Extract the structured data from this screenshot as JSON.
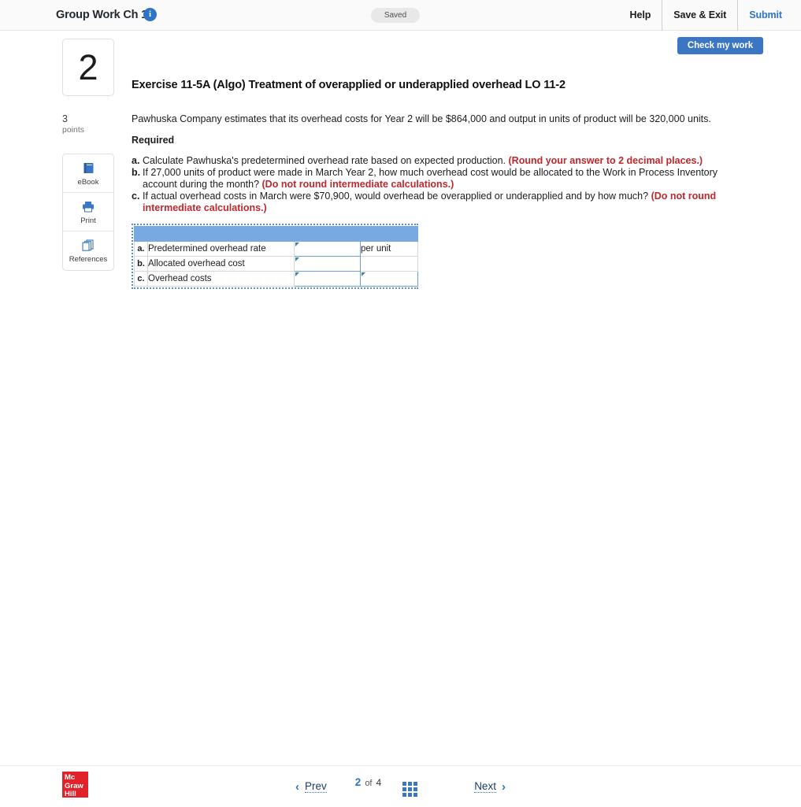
{
  "topbar": {
    "assignment_title": "Group Work Ch 11",
    "info_icon": "info-icon",
    "save_status": "Saved",
    "help_label": "Help",
    "save_exit_label": "Save & Exit",
    "submit_label": "Submit"
  },
  "toolbar": {
    "check_my_work_label": "Check my work"
  },
  "sidebar": {
    "question_number": "2",
    "points_value": "3",
    "points_label": "points",
    "tools": [
      {
        "label": "eBook",
        "icon": "ebook-icon"
      },
      {
        "label": "Print",
        "icon": "print-icon"
      },
      {
        "label": "References",
        "icon": "references-icon"
      }
    ]
  },
  "question": {
    "title": "Exercise 11-5A (Algo) Treatment of overapplied or underapplied overhead LO 11-2",
    "stem": "Pawhuska Company estimates that its overhead costs for Year 2 will be $864,000 and output in units of product will be 320,000 units.",
    "required_label": "Required",
    "requirements": [
      {
        "marker": "a.",
        "text": "Calculate Pawhuska's predetermined overhead rate based on expected production.",
        "highlight": "(Round your answer to 2 decimal places.)"
      },
      {
        "marker": "b.",
        "text": "If 27,000 units of product were made in March Year 2, how much overhead cost would be allocated to the Work in Process Inventory account during the month?",
        "highlight": "(Do not round intermediate calculations.)"
      },
      {
        "marker": "c.",
        "text": "If actual overhead costs in March were $70,900, would overhead be overapplied or underapplied and by how much?",
        "highlight": "(Do not round intermediate calculations.)"
      }
    ]
  },
  "answer_table": {
    "header_cells": [
      "",
      "",
      "",
      ""
    ],
    "rows": [
      {
        "marker": "a.",
        "label": "Predetermined overhead rate",
        "input_value": "",
        "unit_text": "per unit",
        "second_input": false
      },
      {
        "marker": "b.",
        "label": "Allocated overhead cost",
        "input_value": "",
        "unit_text": "",
        "second_input": false
      },
      {
        "marker": "c.",
        "label": "Overhead costs",
        "input_value": "",
        "unit_text": "",
        "second_input": true,
        "second_input_value": ""
      }
    ]
  },
  "footer": {
    "logo_line1": "Mc",
    "logo_line2": "Graw",
    "logo_line3": "Hill",
    "prev_label": "Prev",
    "next_label": "Next",
    "current_page": "2",
    "of_label": "of",
    "total_pages": "4",
    "grid_icon": "grid-view-icon"
  },
  "colors": {
    "accent_blue": "#2e74c8",
    "button_blue": "#3a76c4",
    "table_header_blue": "#78a9e0",
    "highlight_red": "#c1272d",
    "logo_red": "#e2222b"
  }
}
